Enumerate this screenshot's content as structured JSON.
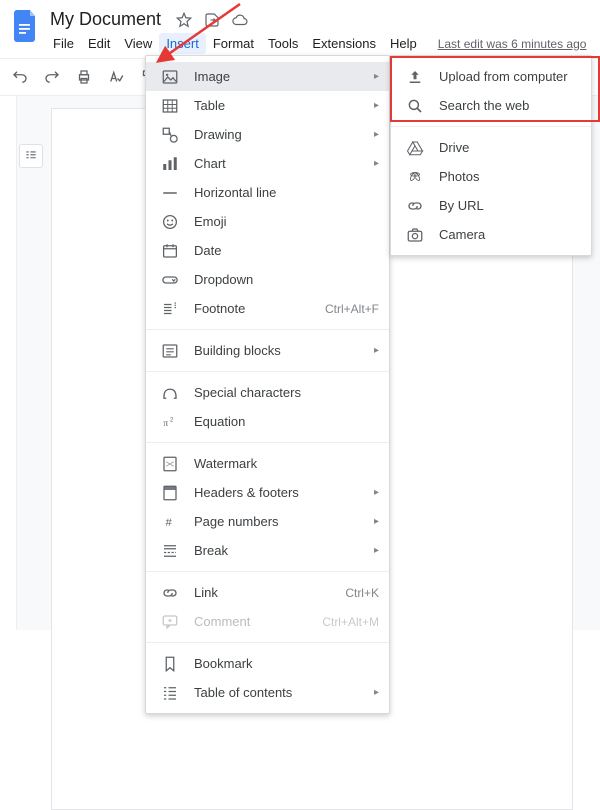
{
  "title": "My Document",
  "last_edit": "Last edit was 6 minutes ago",
  "menubar": [
    "File",
    "Edit",
    "View",
    "Insert",
    "Format",
    "Tools",
    "Extensions",
    "Help"
  ],
  "menubar_active_index": 3,
  "insert_menu": {
    "groups": [
      [
        {
          "icon": "image",
          "label": "Image",
          "sub": true,
          "highlight": true
        },
        {
          "icon": "table",
          "label": "Table",
          "sub": true
        },
        {
          "icon": "drawing",
          "label": "Drawing",
          "sub": true
        },
        {
          "icon": "chart",
          "label": "Chart",
          "sub": true
        },
        {
          "icon": "hr",
          "label": "Horizontal line"
        },
        {
          "icon": "emoji",
          "label": "Emoji"
        },
        {
          "icon": "date",
          "label": "Date"
        },
        {
          "icon": "dropdown",
          "label": "Dropdown"
        },
        {
          "icon": "footnote",
          "label": "Footnote",
          "shortcut": "Ctrl+Alt+F"
        }
      ],
      [
        {
          "icon": "blocks",
          "label": "Building blocks",
          "sub": true
        }
      ],
      [
        {
          "icon": "special",
          "label": "Special characters"
        },
        {
          "icon": "equation",
          "label": "Equation"
        }
      ],
      [
        {
          "icon": "watermark",
          "label": "Watermark"
        },
        {
          "icon": "headers",
          "label": "Headers & footers",
          "sub": true
        },
        {
          "icon": "pagenum",
          "label": "Page numbers",
          "sub": true
        },
        {
          "icon": "break",
          "label": "Break",
          "sub": true
        }
      ],
      [
        {
          "icon": "link",
          "label": "Link",
          "shortcut": "Ctrl+K"
        },
        {
          "icon": "comment",
          "label": "Comment",
          "shortcut": "Ctrl+Alt+M",
          "disabled": true
        }
      ],
      [
        {
          "icon": "bookmark",
          "label": "Bookmark"
        },
        {
          "icon": "toc",
          "label": "Table of contents",
          "sub": true
        }
      ]
    ]
  },
  "image_submenu": {
    "groups": [
      [
        {
          "icon": "upload",
          "label": "Upload from computer"
        },
        {
          "icon": "search",
          "label": "Search the web"
        }
      ],
      [
        {
          "icon": "drive",
          "label": "Drive"
        },
        {
          "icon": "photos",
          "label": "Photos"
        },
        {
          "icon": "url",
          "label": "By URL"
        },
        {
          "icon": "camera",
          "label": "Camera"
        }
      ]
    ]
  }
}
